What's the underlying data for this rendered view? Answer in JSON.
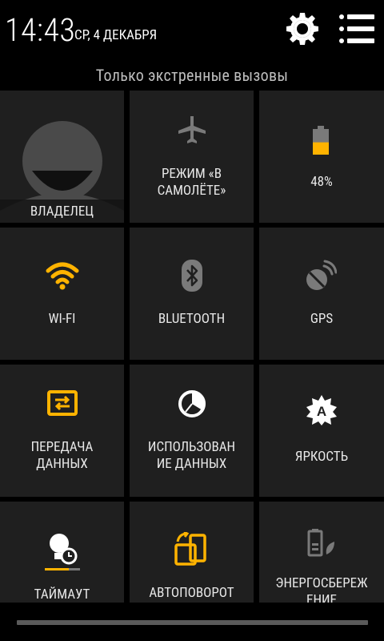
{
  "status": {
    "time": "14:43",
    "date": "СР, 4 ДЕКАБРЯ"
  },
  "emergency_text": "Только экстренные вызовы",
  "tiles": {
    "owner": "ВЛАДЕЛЕЦ",
    "airplane_line1": "РЕЖИМ «В",
    "airplane_line2": "САМОЛЁТЕ»",
    "battery": "48%",
    "wifi": "WI-FI",
    "bluetooth": "BLUETOOTH",
    "gps": "GPS",
    "data_transfer_line1": "ПЕРЕДАЧА",
    "data_transfer_line2": "ДАННЫХ",
    "data_usage_line1": "ИСПОЛЬЗОВАН",
    "data_usage_line2": "ИЕ ДАННЫХ",
    "brightness": "ЯРКОСТЬ",
    "timeout": "ТАЙМАУТ",
    "autorotate": "АВТОПОВОРОТ",
    "power_saving_line1": "ЭНЕРГОСБЕРЕЖ",
    "power_saving_line2": "ЕНИЕ"
  },
  "icons": {
    "settings": "gear-icon",
    "menu": "list-menu-icon",
    "owner": "avatar-icon",
    "airplane": "airplane-icon",
    "battery": "battery-icon",
    "wifi": "wifi-icon",
    "bluetooth": "bluetooth-icon",
    "gps": "gps-icon",
    "data_transfer": "data-transfer-icon",
    "data_usage": "data-usage-icon",
    "brightness": "brightness-icon",
    "timeout": "timeout-icon",
    "autorotate": "autorotate-icon",
    "power_saving": "power-saving-icon"
  },
  "battery_level": 0.48,
  "colors": {
    "accent": "#ffb300",
    "tile_bg": "#1f1f1f",
    "inactive_icon": "#7a7a7a",
    "background": "#000000"
  }
}
